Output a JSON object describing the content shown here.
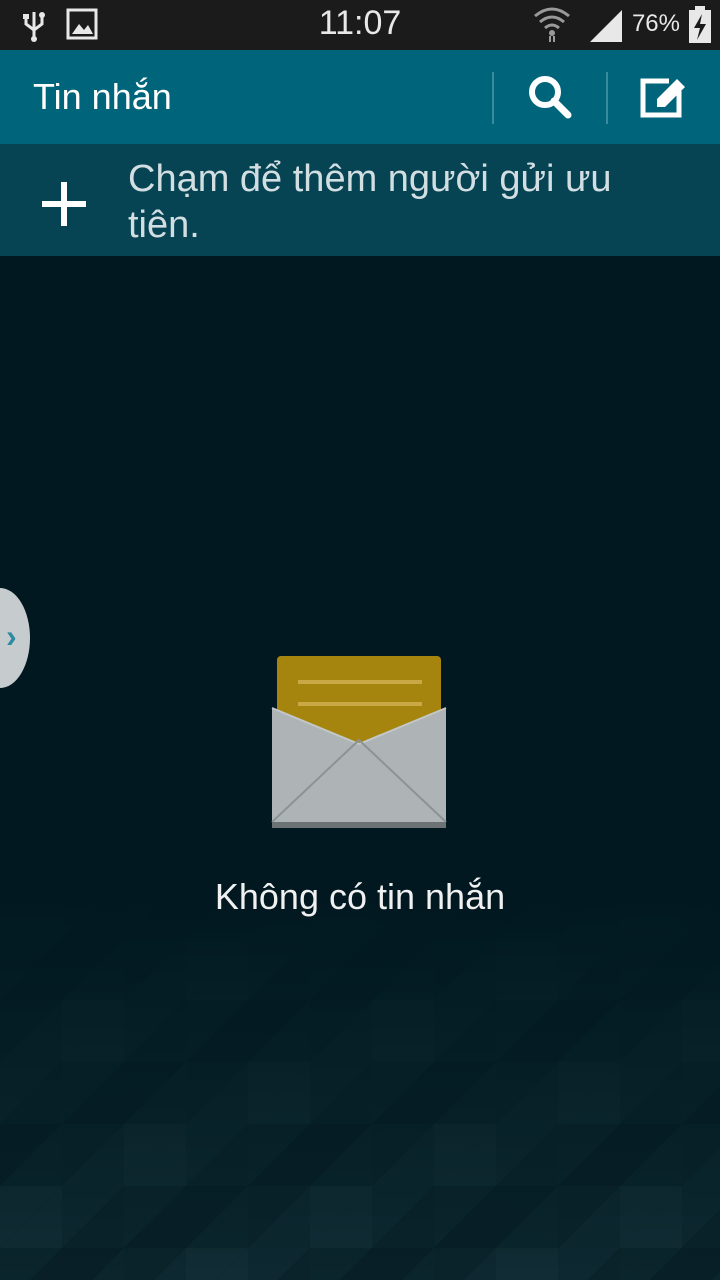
{
  "status_bar": {
    "time": "11:07",
    "battery": "76%",
    "icons": [
      "usb-icon",
      "image-notification-icon",
      "wifi-icon",
      "signal-icon",
      "battery-charging-icon"
    ]
  },
  "action_bar": {
    "title": "Tin nhắn",
    "buttons": [
      "search-icon",
      "compose-icon"
    ],
    "background": "#00657a"
  },
  "priority_senders": {
    "hint": "Chạm để thêm người gửi ưu tiên.",
    "icon": "plus-icon",
    "background": "#064454"
  },
  "empty_state": {
    "icon": "envelope-icon",
    "message": "Không có tin nhắn"
  },
  "side_panel": {
    "icon": "chevron-right-icon"
  }
}
